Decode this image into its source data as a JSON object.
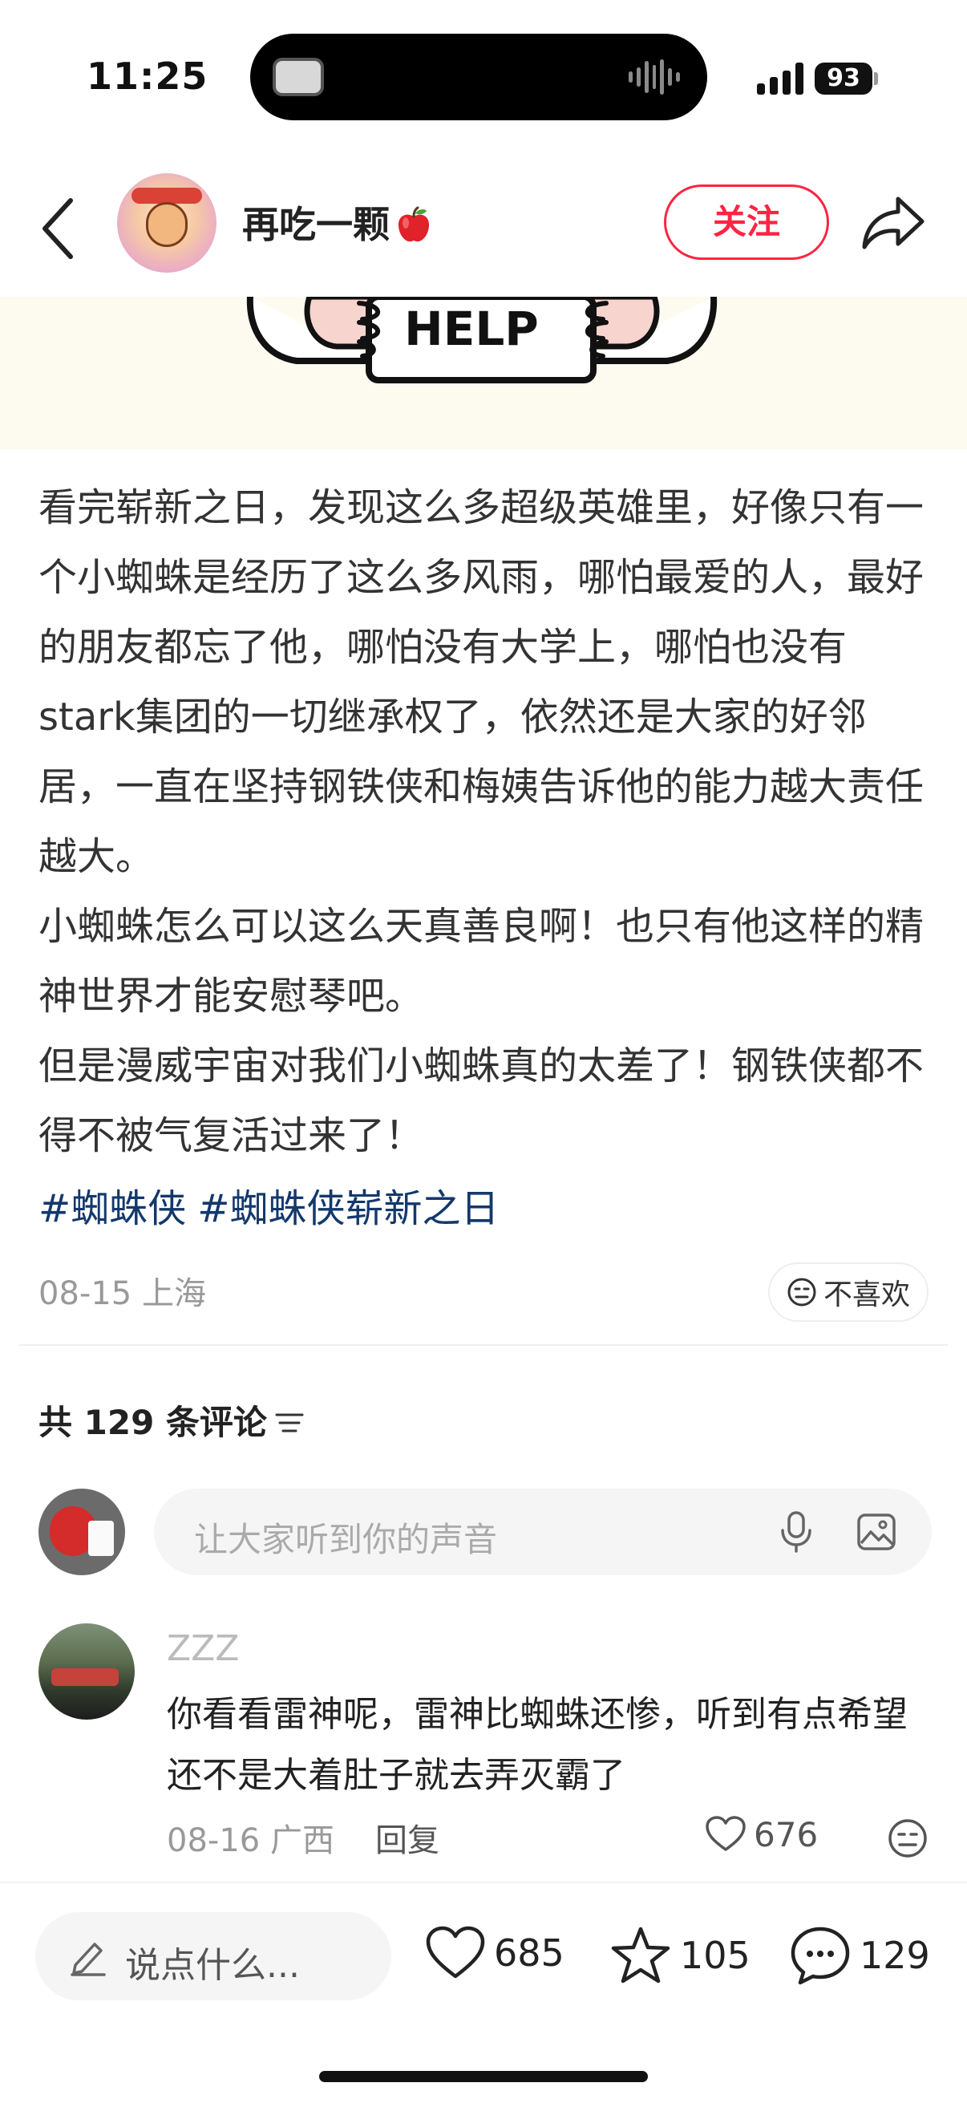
{
  "status_bar": {
    "time": "11:25",
    "battery": "93"
  },
  "header": {
    "author_name": "再吃一颗",
    "follow_label": "关注"
  },
  "post_image": {
    "visible_text": "HELP"
  },
  "post": {
    "paragraphs": [
      "看完崭新之日，发现这么多超级英雄里，好像只有一个小蜘蛛是经历了这么多风雨，哪怕最爱的人，最好的朋友都忘了他，哪怕没有大学上，哪怕也没有stark集团的一切继承权了，依然还是大家的好邻居，一直在坚持钢铁侠和梅姨告诉他的能力越大责任越大。",
      "小蜘蛛怎么可以这么天真善良啊！也只有他这样的精神世界才能安慰琴吧。",
      "但是漫威宇宙对我们小蜘蛛真的太差了！钢铁侠都不得不被气复活过来了！"
    ],
    "tags": [
      "#蜘蛛侠",
      "#蜘蛛侠崭新之日"
    ],
    "date_location": "08-15 上海",
    "dislike_label": "不喜欢"
  },
  "comments": {
    "count_label": "共 129 条评论",
    "input_placeholder": "让大家听到你的声音",
    "items": [
      {
        "user": "ZZZ",
        "text": "你看看雷神呢，雷神比蜘蛛还惨，听到有点希望还不是大着肚子就去弄灭霸了",
        "date_location": "08-16 广西",
        "reply_label": "回复",
        "likes": "676"
      }
    ]
  },
  "bottom_bar": {
    "say_placeholder": "说点什么...",
    "likes": "685",
    "favorites": "105",
    "comments": "129"
  },
  "colors": {
    "accent": "#ff2442",
    "tag": "#13386c",
    "muted": "#999999"
  }
}
